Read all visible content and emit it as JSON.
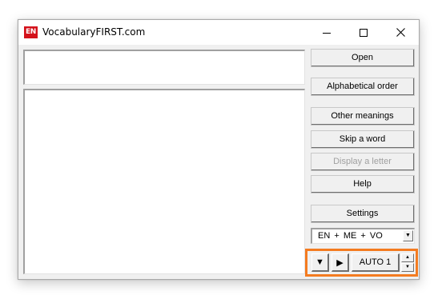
{
  "window": {
    "title": "VocabularyFIRST.com",
    "app_icon_text": "EN",
    "controls": {
      "minimize": "minimize-icon",
      "maximize": "maximize-icon",
      "close": "close-icon"
    }
  },
  "main": {
    "word_text": "",
    "meaning_text": ""
  },
  "buttons": {
    "open": "Open",
    "alphabetical_order": "Alphabetical order",
    "other_meanings": "Other meanings",
    "skip_word": "Skip a word",
    "display_letter": "Display a letter",
    "help": "Help",
    "settings": "Settings"
  },
  "language_select": {
    "value": "EN + ME + VO"
  },
  "playback": {
    "down_icon": "▼",
    "play_icon": "▶",
    "auto_label": "AUTO 1",
    "spin_up": "▲",
    "spin_down": "▼"
  },
  "colors": {
    "highlight": "#f47b20",
    "app_icon_bg": "#d4121b",
    "window_bg": "#f0f0f0"
  }
}
